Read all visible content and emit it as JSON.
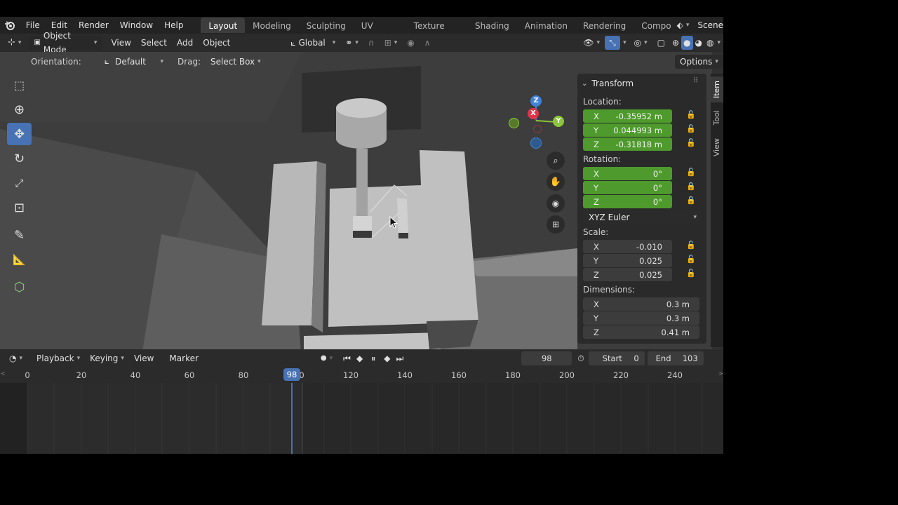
{
  "topbar": {
    "menus": [
      "File",
      "Edit",
      "Render",
      "Window",
      "Help"
    ],
    "workspaces": [
      "Layout",
      "Modeling",
      "Sculpting",
      "UV Editing",
      "Texture Paint",
      "Shading",
      "Animation",
      "Rendering",
      "Compo"
    ],
    "active_workspace": "Layout",
    "scene_label": "Scene"
  },
  "header": {
    "mode": "Object Mode",
    "menus": [
      "View",
      "Select",
      "Add",
      "Object"
    ],
    "transform_orientation": "Global"
  },
  "tool_header": {
    "orientation_label": "Orientation:",
    "orientation_value": "Default",
    "drag_label": "Drag:",
    "drag_value": "Select Box",
    "options_label": "Options"
  },
  "gizmo": {
    "z": "Z",
    "x": "X",
    "y": "Y"
  },
  "npanel": {
    "tabs": [
      "Item",
      "Tool",
      "View"
    ],
    "active_tab": "Item",
    "section_title": "Transform",
    "location_label": "Location:",
    "location": [
      {
        "axis": "X",
        "value": "-0.35952 m"
      },
      {
        "axis": "Y",
        "value": "0.044993 m"
      },
      {
        "axis": "Z",
        "value": "-0.31818 m"
      }
    ],
    "rotation_label": "Rotation:",
    "rotation": [
      {
        "axis": "X",
        "value": "0°"
      },
      {
        "axis": "Y",
        "value": "0°"
      },
      {
        "axis": "Z",
        "value": "0°"
      }
    ],
    "rotation_mode": "XYZ Euler",
    "scale_label": "Scale:",
    "scale": [
      {
        "axis": "X",
        "value": "-0.010"
      },
      {
        "axis": "Y",
        "value": "0.025"
      },
      {
        "axis": "Z",
        "value": "0.025"
      }
    ],
    "dimensions_label": "Dimensions:",
    "dimensions": [
      {
        "axis": "X",
        "value": "0.3 m"
      },
      {
        "axis": "Y",
        "value": "0.3 m"
      },
      {
        "axis": "Z",
        "value": "0.41 m"
      }
    ]
  },
  "timeline": {
    "menus": [
      "Playback",
      "Keying",
      "View",
      "Marker"
    ],
    "current_frame": "98",
    "start_label": "Start",
    "start_value": "0",
    "end_label": "End",
    "end_value": "103",
    "ruler": [
      "0",
      "20",
      "40",
      "60",
      "80",
      "120",
      "140",
      "160",
      "180",
      "200",
      "220",
      "240"
    ],
    "playhead": "98"
  },
  "colors": {
    "accent": "#4772b3",
    "field_green": "#4e9a2c",
    "axis_x": "#e0344a",
    "axis_y": "#8bc53a",
    "axis_z": "#3f82d9"
  }
}
